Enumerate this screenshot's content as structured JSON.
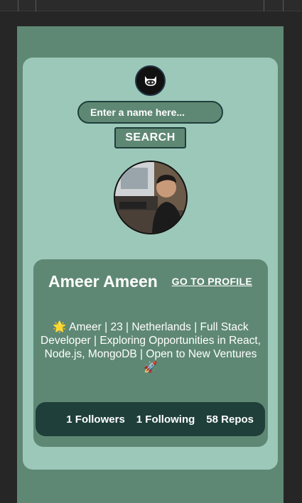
{
  "search": {
    "placeholder": "Enter a name here...",
    "button_label": "SEARCH"
  },
  "profile": {
    "name": "Ameer Ameen",
    "link_label": "GO TO PROFILE",
    "bio": "🌟 Ameer | 23 | Netherlands | Full Stack Developer | Exploring Opportunities in React, Node.js, MongoDB | Open to New Ventures 🚀",
    "stats": {
      "followers": "1 Followers",
      "following": "1 Following",
      "repos": "58 Repos"
    }
  },
  "icons": {
    "logo": "github-octocat-icon",
    "avatar": "user-avatar"
  },
  "colors": {
    "viewport_bg": "#5f8874",
    "card_bg": "#9cc8b9",
    "stats_bg": "#1e3f3a",
    "text": "#ffffff"
  }
}
